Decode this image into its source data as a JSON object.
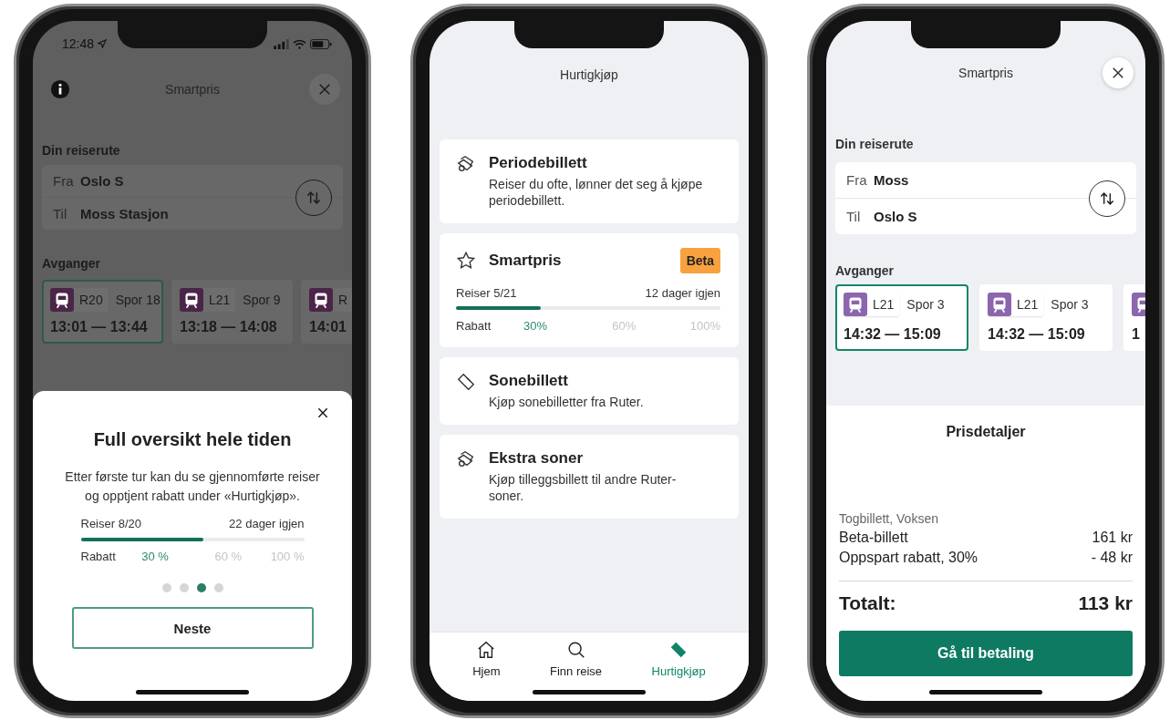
{
  "onboarding_screen": {
    "backdrop_dimmed": true,
    "status_bar": {
      "time": "12:48"
    },
    "header": {
      "title": "Smartpris"
    },
    "route": {
      "heading": "Din reiserute",
      "from_label": "Fra",
      "from": "Oslo S",
      "to_label": "Til",
      "to": "Moss Stasjon"
    },
    "departures": {
      "heading": "Avganger",
      "items": [
        {
          "line": "R20",
          "track": "Spor 18",
          "time": "13:01 — 13:44",
          "selected": true
        },
        {
          "line": "L21",
          "track": "Spor 9",
          "time": "13:18 — 14:08",
          "selected": false
        },
        {
          "line": "R",
          "time": "14:01",
          "selected": false
        }
      ]
    },
    "sheet": {
      "title": "Full oversikt hele tiden",
      "text": "Etter første tur kan du se gjennomførte reiser og opptjent rabatt under «Hurtigkjøp».",
      "progress": {
        "trips": "Reiser 8/20",
        "days_left": "22 dager igjen",
        "level": 0.55,
        "discount_label": "Rabatt",
        "steps": [
          {
            "label": "30 %",
            "reached": true
          },
          {
            "label": "60 %",
            "reached": false
          },
          {
            "label": "100 %",
            "reached": false
          }
        ]
      },
      "pages": [
        {
          "selected": false
        },
        {
          "selected": false
        },
        {
          "selected": true
        },
        {
          "selected": false
        }
      ],
      "button": "Neste"
    }
  },
  "quick_buy_screen": {
    "header": {
      "title": "Hurtigkjøp"
    },
    "products": [
      {
        "kind": "period",
        "title": "Periodebillett",
        "text": "Reiser du ofte, lønner det seg å kjøpe periodebillett."
      },
      {
        "kind": "smartpris",
        "title": "Smartpris",
        "badge": "Beta",
        "progress": {
          "trips": "Reiser 5/21",
          "days_left": "12 dager igjen",
          "level": 0.32,
          "discount_label": "Rabatt",
          "steps": [
            {
              "label": "30%",
              "reached": true
            },
            {
              "label": "60%",
              "reached": false
            },
            {
              "label": "100%",
              "reached": false
            }
          ]
        }
      },
      {
        "kind": "zone",
        "title": "Sonebillett",
        "text": "Kjøp sonebilletter fra Ruter."
      },
      {
        "kind": "extra_zone",
        "title": "Ekstra soner",
        "text": "Kjøp tilleggsbillett til andre Ruter-soner."
      }
    ],
    "tab_bar": [
      {
        "kind": "home",
        "label": "Hjem",
        "selected": false
      },
      {
        "kind": "search",
        "label": "Finn reise",
        "selected": false
      },
      {
        "kind": "ticket",
        "label": "Hurtigkjøp",
        "selected": true
      }
    ]
  },
  "price_screen": {
    "header": {
      "title": "Smartpris"
    },
    "route": {
      "heading": "Din reiserute",
      "from_label": "Fra",
      "from": "Moss",
      "to_label": "Til",
      "to": "Oslo S"
    },
    "departures": {
      "heading": "Avganger",
      "items": [
        {
          "line": "L21",
          "track": "Spor 3",
          "time": "14:32 — 15:09",
          "selected": true
        },
        {
          "line": "L21",
          "track": "Spor 3",
          "time": "14:32 — 15:09",
          "selected": false
        },
        {
          "time": "1",
          "selected": false
        }
      ]
    },
    "price_details": {
      "title": "Prisdetaljer",
      "caption": "Togbillett, Voksen",
      "lines": [
        {
          "label": "Beta-billett",
          "amount": "161 kr"
        },
        {
          "label": "Oppspart rabatt, 30%",
          "amount": "- 48 kr"
        }
      ],
      "total_label": "Totalt:",
      "total": "113 kr"
    },
    "button": "Gå til betaling"
  }
}
